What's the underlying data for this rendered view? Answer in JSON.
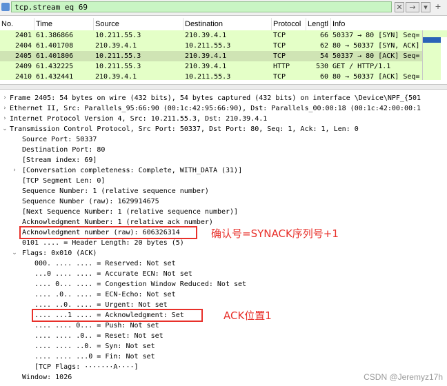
{
  "filter": {
    "value": "tcp.stream eq 69",
    "clear_label": "✕",
    "apply_label": "→",
    "dropdown_label": "▾",
    "add_label": "+"
  },
  "packet_list": {
    "columns": [
      "No.",
      "Time",
      "Source",
      "Destination",
      "Protocol",
      "Lengtl",
      "Info"
    ],
    "rows": [
      {
        "no": "2401",
        "time": "61.386866",
        "src": "10.211.55.3",
        "dst": "210.39.4.1",
        "proto": "TCP",
        "len": "66",
        "info": "50337 → 80 [SYN] Seq="
      },
      {
        "no": "2404",
        "time": "61.401708",
        "src": "210.39.4.1",
        "dst": "10.211.55.3",
        "proto": "TCP",
        "len": "62",
        "info": "80 → 50337 [SYN, ACK]"
      },
      {
        "no": "2405",
        "time": "61.401806",
        "src": "10.211.55.3",
        "dst": "210.39.4.1",
        "proto": "TCP",
        "len": "54",
        "info": "50337 → 80 [ACK] Seq="
      },
      {
        "no": "2409",
        "time": "61.432225",
        "src": "10.211.55.3",
        "dst": "210.39.4.1",
        "proto": "HTTP",
        "len": "530",
        "info": "GET / HTTP/1.1"
      },
      {
        "no": "2410",
        "time": "61.432441",
        "src": "210.39.4.1",
        "dst": "10.211.55.3",
        "proto": "TCP",
        "len": "60",
        "info": "80 → 50337 [ACK] Seq="
      }
    ]
  },
  "details": {
    "lines": [
      "Frame 2405: 54 bytes on wire (432 bits), 54 bytes captured (432 bits) on interface \\Device\\NPF_{501",
      "Ethernet II, Src: Parallels_95:66:90 (00:1c:42:95:66:90), Dst: Parallels_00:00:18 (00:1c:42:00:00:1",
      "Internet Protocol Version 4, Src: 10.211.55.3, Dst: 210.39.4.1",
      "Transmission Control Protocol, Src Port: 50337, Dst Port: 80, Seq: 1, Ack: 1, Len: 0",
      "Source Port: 50337",
      "Destination Port: 80",
      "[Stream index: 69]",
      "[Conversation completeness: Complete, WITH_DATA (31)]",
      "[TCP Segment Len: 0]",
      "Sequence Number: 1    (relative sequence number)",
      "Sequence Number (raw): 1629914675",
      "[Next Sequence Number: 1    (relative sequence number)]",
      "Acknowledgment Number: 1    (relative ack number)",
      "Acknowledgment number (raw): 606326314",
      "0101 .... = Header Length: 20 bytes (5)",
      "Flags: 0x010 (ACK)",
      "000. .... .... = Reserved: Not set",
      "...0 .... .... = Accurate ECN: Not set",
      ".... 0... .... = Congestion Window Reduced: Not set",
      ".... .0.. .... = ECN-Echo: Not set",
      ".... ..0. .... = Urgent: Not set",
      ".... ...1 .... = Acknowledgment: Set",
      ".... .... 0... = Push: Not set",
      ".... .... .0.. = Reset: Not set",
      ".... .... ..0. = Syn: Not set",
      ".... .... ...0 = Fin: Not set",
      "[TCP Flags: ·······A····]",
      "Window: 1026"
    ]
  },
  "annotations": {
    "synack": "确认号=SYNACK序列号+1",
    "ackflag": "ACK位置1"
  },
  "watermark": "CSDN @Jeremyz17h",
  "colors": {
    "filter_ok": "#c9f5c4",
    "tcp_row": "#e4ffc7",
    "selected_row": "#cfe4b4",
    "annotation_red": "#e8302a"
  }
}
